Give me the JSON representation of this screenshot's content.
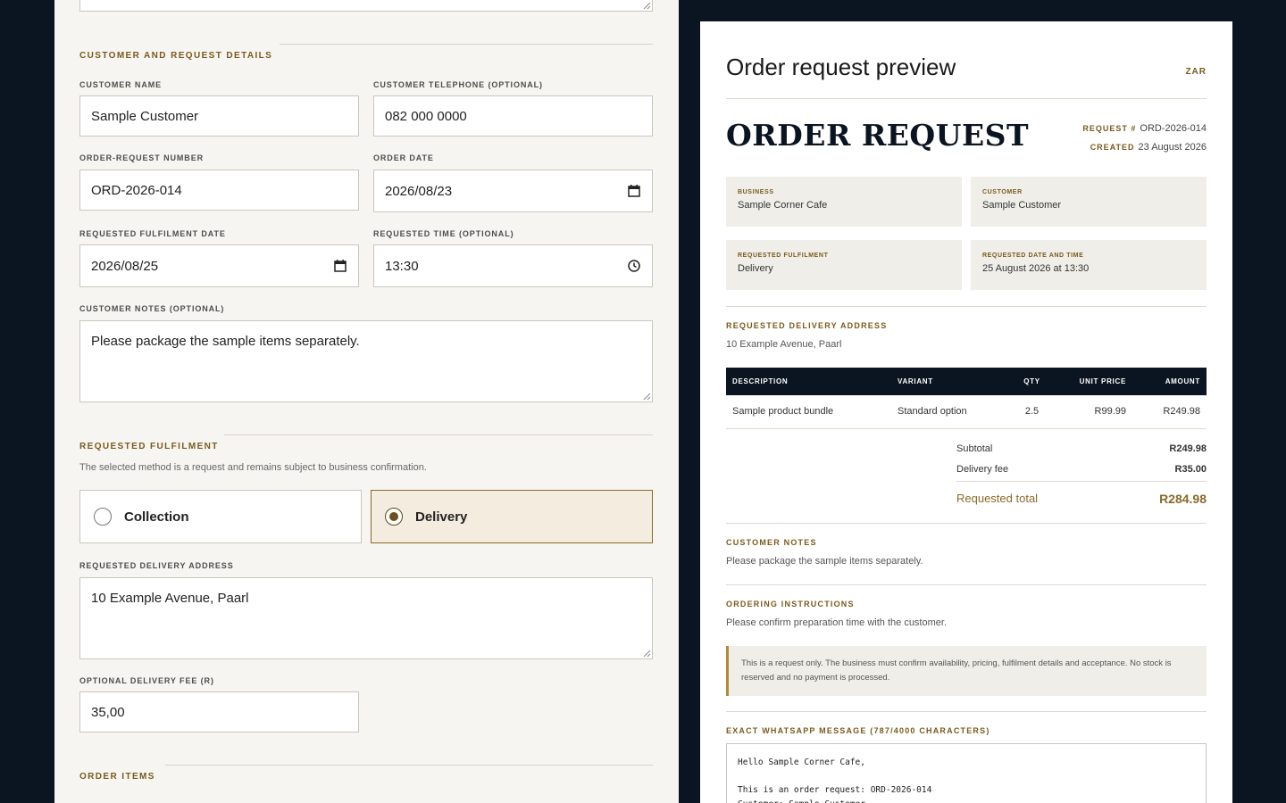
{
  "form": {
    "customer_section_title": "CUSTOMER AND REQUEST DETAILS",
    "customer_name": {
      "label": "CUSTOMER NAME",
      "value": "Sample Customer"
    },
    "customer_telephone": {
      "label": "CUSTOMER TELEPHONE (OPTIONAL)",
      "value": "082 000 0000"
    },
    "order_request_number": {
      "label": "ORDER-REQUEST NUMBER",
      "value": "ORD-2026-014"
    },
    "order_date": {
      "label": "ORDER DATE",
      "value": "2026/08/23"
    },
    "fulfilment_date": {
      "label": "REQUESTED FULFILMENT DATE",
      "value": "2026/08/25"
    },
    "requested_time": {
      "label": "REQUESTED TIME (OPTIONAL)",
      "value": "13:30"
    },
    "customer_notes": {
      "label": "CUSTOMER NOTES (OPTIONAL)",
      "value": "Please package the sample items separately."
    },
    "fulfilment_section_title": "REQUESTED FULFILMENT",
    "fulfilment_note": "The selected method is a request and remains subject to business confirmation.",
    "options": {
      "collection": "Collection",
      "delivery": "Delivery",
      "selected": "delivery"
    },
    "delivery_address": {
      "label": "REQUESTED DELIVERY ADDRESS",
      "value": "10 Example Avenue, Paarl"
    },
    "delivery_fee": {
      "label": "OPTIONAL DELIVERY FEE (R)",
      "value": "35,00"
    },
    "items_section_title": "ORDER ITEMS"
  },
  "preview": {
    "title": "Order request preview",
    "currency": "ZAR",
    "doc_title": "ORDER REQUEST",
    "request_label": "REQUEST #",
    "request_no": "ORD-2026-014",
    "created_label": "CREATED",
    "created_date": "23 August 2026",
    "cards": {
      "business_k": "BUSINESS",
      "business_v": "Sample Corner Cafe",
      "customer_k": "CUSTOMER",
      "customer_v": "Sample Customer",
      "fulfilment_k": "REQUESTED FULFILMENT",
      "fulfilment_v": "Delivery",
      "datetime_k": "REQUESTED DATE AND TIME",
      "datetime_v": "25 August 2026 at 13:30"
    },
    "address_h": "REQUESTED DELIVERY ADDRESS",
    "address_t": "10 Example Avenue, Paarl",
    "table": {
      "headers": [
        "DESCRIPTION",
        "VARIANT",
        "QTY",
        "UNIT PRICE",
        "AMOUNT"
      ],
      "rows": [
        [
          "Sample product bundle",
          "Standard option",
          "2.5",
          "R99.99",
          "R249.98"
        ]
      ]
    },
    "subtotal_label": "Subtotal",
    "subtotal": "R249.98",
    "fee_label": "Delivery fee",
    "fee": "R35.00",
    "total_label": "Requested total",
    "total": "R284.98",
    "notes_h": "CUSTOMER NOTES",
    "notes_t": "Please package the sample items separately.",
    "instr_h": "ORDERING INSTRUCTIONS",
    "instr_t": "Please confirm preparation time with the customer.",
    "disclaimer": "This is a request only. The business must confirm availability, pricing, fulfilment details and acceptance. No stock is reserved and no payment is processed.",
    "whatsapp_h": "EXACT WHATSAPP MESSAGE (787/4000 CHARACTERS)",
    "whatsapp_text": "Hello Sample Corner Cafe,\n\nThis is an order request: ORD-2026-014\nCustomer: Sample Customer"
  },
  "colors": {
    "accent": "#7a5a1c",
    "dark": "#0b1521",
    "panel": "#f6f5f1",
    "selected": "#f3ecdf"
  }
}
